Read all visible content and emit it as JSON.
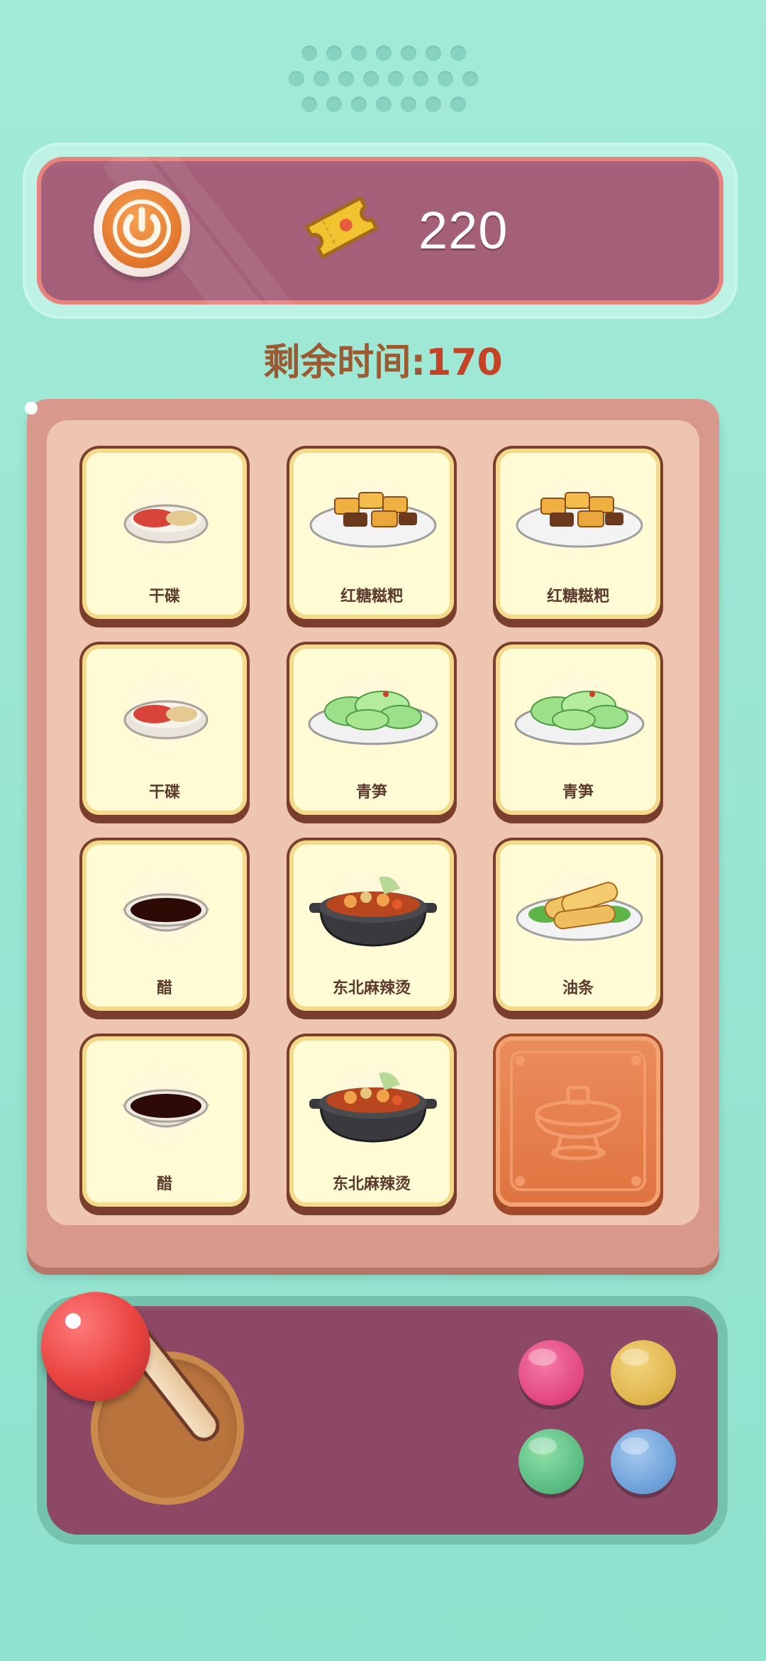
{
  "score": "220",
  "timer": {
    "label": "剩余时间",
    "colon": ":",
    "value": "170"
  },
  "cards": [
    {
      "label": "干碟",
      "food": "sauce-red"
    },
    {
      "label": "红糖糍粑",
      "food": "ciba"
    },
    {
      "label": "红糖糍粑",
      "food": "ciba"
    },
    {
      "label": "干碟",
      "food": "sauce-red"
    },
    {
      "label": "青笋",
      "food": "greens"
    },
    {
      "label": "青笋",
      "food": "greens"
    },
    {
      "label": "醋",
      "food": "vinegar"
    },
    {
      "label": "东北麻辣烫",
      "food": "hotpot"
    },
    {
      "label": "油条",
      "food": "youtiao"
    },
    {
      "label": "醋",
      "food": "vinegar"
    },
    {
      "label": "东北麻辣烫",
      "food": "hotpot"
    },
    {
      "label": "",
      "food": "card-back-hotpot-icon"
    }
  ],
  "colors": {
    "background": "#a3ead8",
    "panel": "#a45f79",
    "controller": "#8c4865",
    "button_pink": "#e94b83",
    "button_yellow": "#e2b74e",
    "button_green": "#5ec48a",
    "button_blue": "#6fa3db"
  }
}
